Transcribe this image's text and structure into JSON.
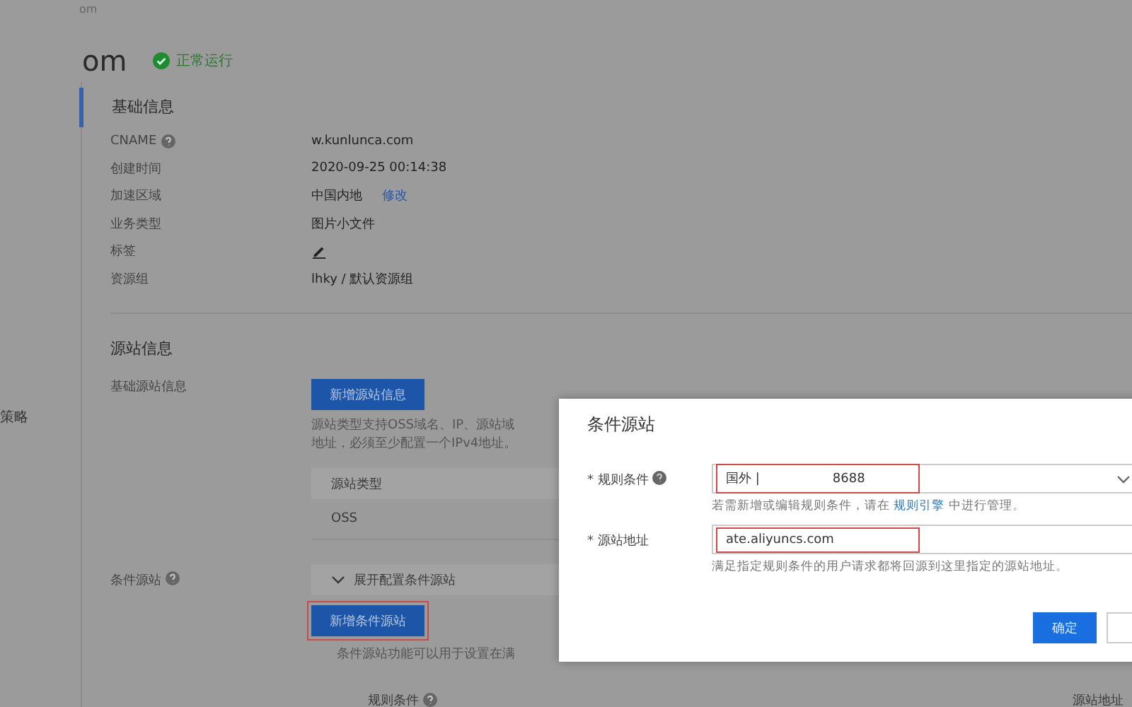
{
  "breadcrumb": "om",
  "title": "om",
  "status": {
    "label": "正常运行",
    "kind": "running"
  },
  "sidebar": {
    "items": [
      {
        "label": "策略",
        "selected": false
      }
    ]
  },
  "basic_info": {
    "heading": "基础信息",
    "active": true,
    "rows": [
      {
        "label": "CNAME",
        "help": true,
        "kind": "text",
        "value": "w.kunlunca.com"
      },
      {
        "label": "创建时间",
        "help": false,
        "kind": "text",
        "value": "2020-09-25 00:14:38"
      },
      {
        "label": "加速区域",
        "help": false,
        "kind": "text_link",
        "value": "中国内地",
        "link": "修改"
      },
      {
        "label": "业务类型",
        "help": false,
        "kind": "text",
        "value": "图片小文件"
      },
      {
        "label": "标签",
        "help": false,
        "kind": "edit"
      },
      {
        "label": "资源组",
        "help": false,
        "kind": "text",
        "value": "lhky  /  默认资源组"
      }
    ]
  },
  "origin_info": {
    "heading": "源站信息",
    "basic_origin": {
      "label": "基础源站信息",
      "button": {
        "label": "新增源站信息",
        "highlighted": false
      },
      "description": [
        "源站类型支持OSS域名、IP、源站域",
        "地址，必须至少配置一个IPv4地址。"
      ],
      "table": {
        "columns": [
          "源站类型"
        ],
        "rows": [
          [
            "OSS"
          ]
        ]
      }
    },
    "conditional_origin": {
      "label": "条件源站",
      "help": true,
      "expander": {
        "label": "展开配置条件源站",
        "expanded": true
      },
      "button": {
        "label": "新增条件源站",
        "highlighted": true
      },
      "description": "条件源站功能可以用于设置在满",
      "table": {
        "columns": [
          {
            "label": "规则条件",
            "help": true
          },
          {
            "label": "源站地址",
            "help": false
          }
        ]
      }
    }
  },
  "modal": {
    "title": "条件源站",
    "fields": [
      {
        "label": "* 规则条件",
        "help": true,
        "kind": "select",
        "value": "国外 |                  8688",
        "highlighted": true,
        "hint": {
          "before": "若需新增或编辑规则条件，请在 ",
          "link": "规则引擎",
          "after": " 中进行管理。"
        }
      },
      {
        "label": "* 源站地址",
        "help": false,
        "kind": "input",
        "value": "ate.aliyuncs.com",
        "highlighted": true,
        "hint": {
          "before": "满足指定规则条件的用户请求都将回源到这里指定的源站地址。"
        }
      }
    ],
    "buttons": [
      {
        "label": "确定",
        "kind": "primary"
      },
      {
        "kind": "default"
      }
    ]
  }
}
